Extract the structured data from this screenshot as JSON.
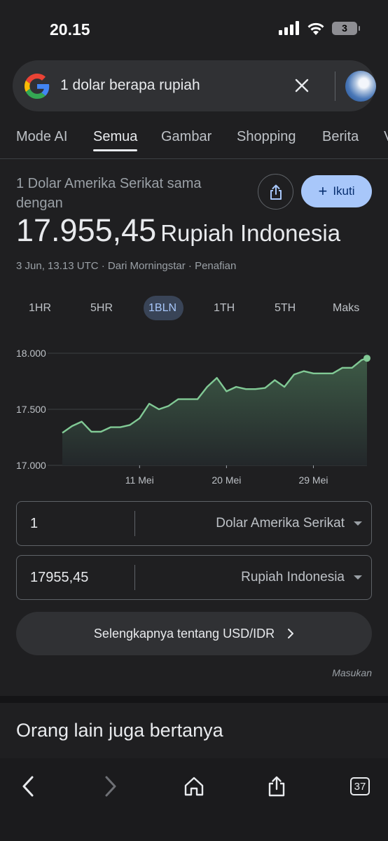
{
  "status_bar": {
    "time": "20.15",
    "battery": "3"
  },
  "search": {
    "query": "1 dolar berapa rupiah"
  },
  "tabs": [
    {
      "label": "Mode AI"
    },
    {
      "label": "Semua"
    },
    {
      "label": "Gambar"
    },
    {
      "label": "Shopping"
    },
    {
      "label": "Berita"
    },
    {
      "label": "V"
    }
  ],
  "converter": {
    "label": "1 Dolar Amerika Serikat sama dengan",
    "value": "17.955,45",
    "unit": "Rupiah Indonesia",
    "meta": "3 Jun, 13.13 UTC · Dari Morningstar · Penafian",
    "follow_label": "Ikuti"
  },
  "ranges": [
    {
      "label": "1HR"
    },
    {
      "label": "5HR"
    },
    {
      "label": "1BLN"
    },
    {
      "label": "1TH"
    },
    {
      "label": "5TH"
    },
    {
      "label": "Maks"
    }
  ],
  "active_range": "1BLN",
  "chart_data": {
    "type": "area",
    "ylim": [
      17000,
      18000
    ],
    "y_ticks": [
      "18.000",
      "17.500",
      "17.000"
    ],
    "y_tick_values": [
      18000,
      17500,
      17000
    ],
    "x_ticks": [
      "11 Mei",
      "20 Mei",
      "29 Mei"
    ],
    "x_tick_dates": [
      "2025-05-11",
      "2025-05-20",
      "2025-05-29"
    ],
    "x": [
      "2025-05-03",
      "2025-05-04",
      "2025-05-05",
      "2025-05-06",
      "2025-05-07",
      "2025-05-08",
      "2025-05-09",
      "2025-05-10",
      "2025-05-11",
      "2025-05-12",
      "2025-05-13",
      "2025-05-14",
      "2025-05-15",
      "2025-05-16",
      "2025-05-17",
      "2025-05-18",
      "2025-05-19",
      "2025-05-20",
      "2025-05-21",
      "2025-05-22",
      "2025-05-23",
      "2025-05-24",
      "2025-05-25",
      "2025-05-26",
      "2025-05-27",
      "2025-05-28",
      "2025-05-29",
      "2025-05-30",
      "2025-05-31",
      "2025-06-01",
      "2025-06-02",
      "2025-06-03",
      "2025-06-03T13:13"
    ],
    "values": [
      17290,
      17350,
      17390,
      17300,
      17300,
      17340,
      17340,
      17360,
      17420,
      17550,
      17500,
      17530,
      17590,
      17590,
      17590,
      17700,
      17780,
      17660,
      17700,
      17680,
      17680,
      17690,
      17760,
      17700,
      17810,
      17840,
      17820,
      17820,
      17820,
      17870,
      17870,
      17940,
      17955
    ],
    "colors": {
      "line": "#81c995",
      "fill_top": "#3d5a46",
      "fill_bottom": "#23272a",
      "grid": "#3c4043"
    }
  },
  "from": {
    "amount": "1",
    "currency": "Dolar Amerika Serikat"
  },
  "to": {
    "amount": "17955,45",
    "currency": "Rupiah Indonesia"
  },
  "more_label": "Selengkapnya tentang USD/IDR",
  "feedback_label": "Masukan",
  "people_also_ask": "Orang lain juga bertanya",
  "bottom_nav": {
    "tab_count": "37"
  }
}
